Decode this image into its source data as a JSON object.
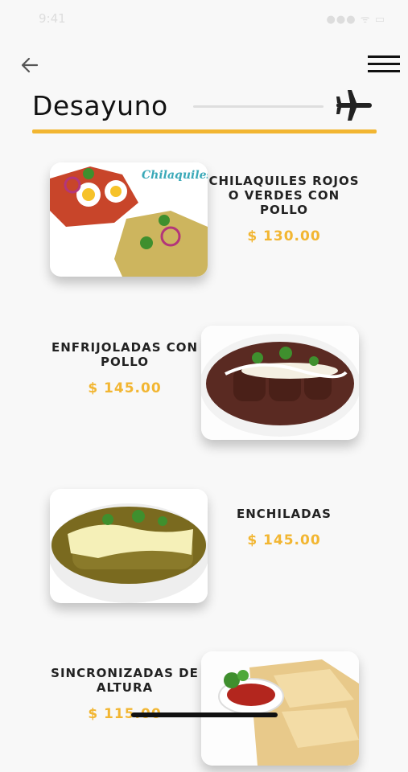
{
  "status_bar": {
    "time": "9:41",
    "icons": "●●● ᯤ ▭"
  },
  "header": {
    "back_icon": "arrow-left-icon",
    "menu_icon": "hamburger-menu-icon"
  },
  "section": {
    "title": "Desayuno",
    "icon": "airplane-icon",
    "accent_color": "#f2b632"
  },
  "items": [
    {
      "name": "CHILAQUILES ROJOS O VERDES CON POLLO",
      "price": "$ 130.00",
      "image_text": "Chilaquiles"
    },
    {
      "name": "ENFRIJOLADAS CON POLLO",
      "price": "$ 145.00"
    },
    {
      "name": "ENCHILADAS",
      "price": "$ 145.00"
    },
    {
      "name": "SINCRONIZADAS DE ALTURA",
      "price": "$ 115.00"
    }
  ]
}
